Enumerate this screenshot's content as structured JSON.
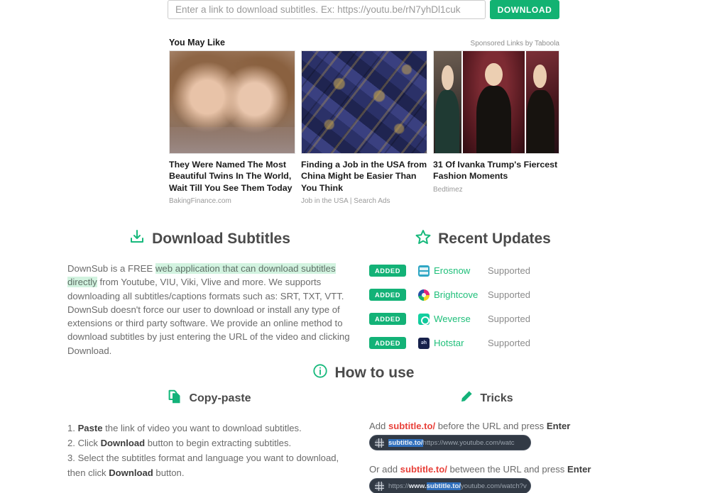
{
  "search": {
    "placeholder": "Enter a link to download subtitles. Ex: https://youtu.be/rN7yhDl1cuk",
    "value": "",
    "download_label": "DOWNLOAD"
  },
  "taboola": {
    "title": "You May Like",
    "sponsored": "Sponsored Links by Taboola",
    "cards": [
      {
        "title": "They Were Named The Most Beautiful Twins In The World, Wait Till You See Them Today",
        "source": "BakingFinance.com",
        "image": "two-girls-photo"
      },
      {
        "title": "Finding a Job in the USA from China Might be Easier Than You Think",
        "source": "Job in the USA | Search Ads",
        "image": "passports-photo"
      },
      {
        "title": "31 Of Ivanka Trump's Fiercest Fashion Moments",
        "source": "Bedtimez",
        "image": "celebrity-collage-photo"
      }
    ]
  },
  "download_subtitles": {
    "heading": "Download Subtitles",
    "icon": "download-icon",
    "paragraph_1_pre": "DownSub is a FREE ",
    "paragraph_1_highlight": "web application that can download subtitles directly",
    "paragraph_1_post": " from Youtube, VIU, Viki, Vlive and more. We supports downloading all subtitles/captions formats such as: SRT, TXT, VTT.",
    "paragraph_2": "DownSub doesn't force our user to download or install any type of extensions or third party software. We provide an online method to download subtitles by just entering the URL of the video and clicking Download."
  },
  "recent_updates": {
    "heading": "Recent Updates",
    "icon": "star-icon",
    "items": [
      {
        "badge": "ADDED",
        "name": "Erosnow",
        "status": "Supported",
        "logo": "erosnow-logo"
      },
      {
        "badge": "ADDED",
        "name": "Brightcove",
        "status": "Supported",
        "logo": "brightcove-logo"
      },
      {
        "badge": "ADDED",
        "name": "Weverse",
        "status": "Supported",
        "logo": "weverse-logo"
      },
      {
        "badge": "ADDED",
        "name": "Hotstar",
        "status": "Supported",
        "logo": "hotstar-logo"
      }
    ]
  },
  "how_to_use": {
    "heading": "How to use",
    "icon": "info-icon"
  },
  "copy_paste": {
    "heading": "Copy-paste",
    "icon": "copy-icon",
    "steps": [
      {
        "num": "1. ",
        "bold": "Paste",
        "rest": " the link of video you want to download subtitles."
      },
      {
        "num": "2. ",
        "pre": "Click ",
        "bold": "Download",
        "rest": " button to begin extracting subtitles."
      },
      {
        "num": "3. ",
        "pre": "Select the subtitles format and language you want to download, then click ",
        "bold": "Download",
        "rest": " button."
      }
    ]
  },
  "tricks": {
    "heading": "Tricks",
    "icon": "pencil-icon",
    "line_1": {
      "pre": "Add ",
      "red": "subtitle.to/",
      "mid": " before the URL and press ",
      "bold": "Enter"
    },
    "url_1": {
      "selected": "subtitle.to/",
      "rest": "https://www.youtube.com/watc"
    },
    "line_2": {
      "pre": "Or add ",
      "red": "subtitle.to/",
      "mid": " between the URL and press ",
      "bold": "Enter"
    },
    "url_2": {
      "pre": "https://",
      "white": "www.",
      "selected": "subtitle.to/",
      "rest": "youtube.com/watch?v"
    }
  },
  "colors": {
    "accent_green": "#12b272",
    "link_green": "#1fbf7a",
    "highlight": "#d2f3e0",
    "red": "#e8413a",
    "urlbar_dark": "#323a45",
    "selection_blue": "#2f6fbd"
  }
}
